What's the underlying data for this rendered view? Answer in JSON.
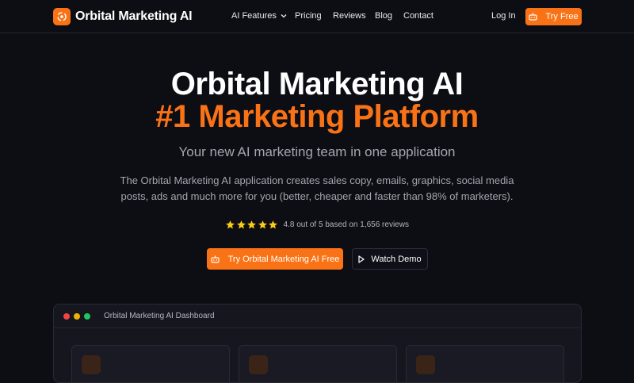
{
  "brand": {
    "name": "Orbital Marketing AI",
    "logo_icon": "orbit-logo-icon"
  },
  "nav": {
    "items": [
      {
        "label": "AI Features",
        "has_dropdown": true
      },
      {
        "label": "Pricing"
      },
      {
        "label": "Reviews"
      },
      {
        "label": "Blog"
      },
      {
        "label": "Contact"
      }
    ],
    "login_label": "Log In",
    "try_label": "Try Free"
  },
  "hero": {
    "title_line1": "Orbital Marketing AI",
    "title_line2": "#1 Marketing Platform",
    "subtitle": "Your new AI marketing team in one application",
    "description": "The Orbital Marketing AI application creates sales copy, emails, graphics, social media posts, ads and much more for you (better, cheaper and faster than 98% of marketers).",
    "rating": {
      "stars": 5,
      "text": "4.8 out of 5 based on 1,656 reviews"
    },
    "cta_primary": "Try Orbital Marketing AI Free",
    "cta_secondary": "Watch Demo"
  },
  "dashboard": {
    "title": "Orbital Marketing AI Dashboard"
  },
  "colors": {
    "accent": "#f97316",
    "background": "#0d0d14",
    "star": "#facc15",
    "muted_text": "#a5a5b0"
  }
}
